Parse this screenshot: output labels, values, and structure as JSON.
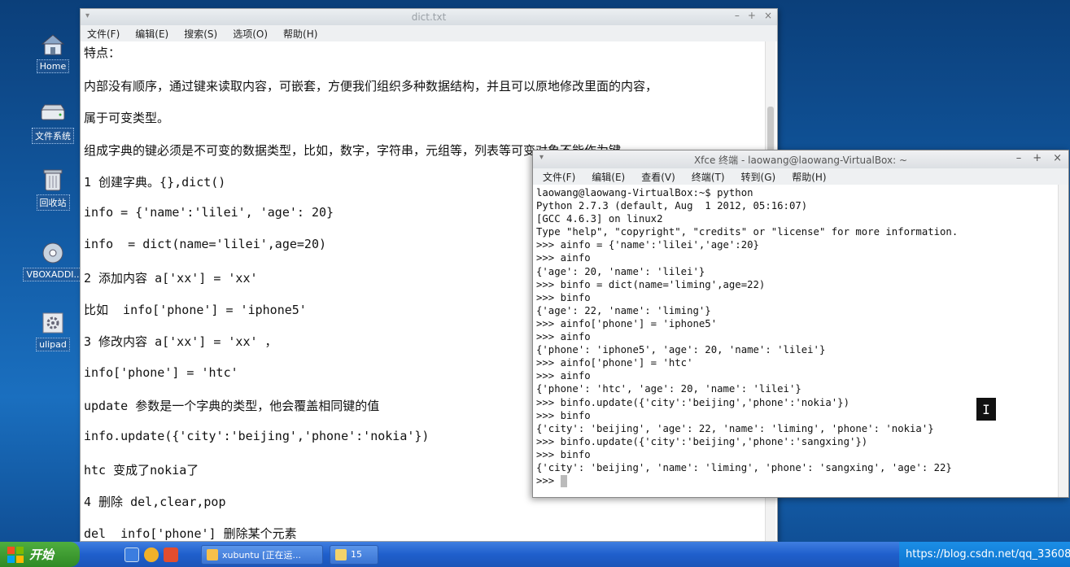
{
  "desktop": {
    "icons": [
      {
        "label": "Home",
        "icon": "home-icon"
      },
      {
        "label": "文件系统",
        "icon": "drive-icon"
      },
      {
        "label": "回收站",
        "icon": "trash-icon"
      },
      {
        "label": "VBOXADDI..",
        "icon": "disc-icon"
      },
      {
        "label": "ulipad",
        "icon": "gear-icon"
      }
    ]
  },
  "editor": {
    "title": "dict.txt",
    "menu": [
      "文件(F)",
      "编辑(E)",
      "搜索(S)",
      "选项(O)",
      "帮助(H)"
    ],
    "lines": [
      "特点：",
      "内部没有顺序，通过键来读取内容，可嵌套，方便我们组织多种数据结构，并且可以原地修改里面的内容，",
      "属于可变类型。",
      "组成字典的键必须是不可变的数据类型，比如，数字，字符串，元组等，列表等可变对象不能作为键。",
      "1 创建字典。{},dict()",
      "info = {'name':'lilei', 'age': 20}",
      "info  = dict(name='lilei',age=20)",
      "2 添加内容 a['xx'] = 'xx'",
      "比如  info['phone'] = 'iphone5'",
      "3 修改内容 a['xx'] = 'xx' ，",
      "info['phone'] = 'htc'",
      "update 参数是一个字典的类型，他会覆盖相同键的值",
      "info.update({'city':'beijing','phone':'nokia'})",
      "htc 变成了nokia了",
      "4 删除 del,clear,pop",
      "del  info['phone'] 删除某个元素"
    ]
  },
  "terminal": {
    "title": "Xfce 终端 - laowang@laowang-VirtualBox: ~",
    "menu": [
      "文件(F)",
      "编辑(E)",
      "查看(V)",
      "终端(T)",
      "转到(G)",
      "帮助(H)"
    ],
    "lines": [
      "laowang@laowang-VirtualBox:~$ python",
      "Python 2.7.3 (default, Aug  1 2012, 05:16:07)",
      "[GCC 4.6.3] on linux2",
      "Type \"help\", \"copyright\", \"credits\" or \"license\" for more information.",
      ">>> ainfo = {'name':'lilei','age':20}",
      ">>> ainfo",
      "{'age': 20, 'name': 'lilei'}",
      ">>> binfo = dict(name='liming',age=22)",
      ">>> binfo",
      "{'age': 22, 'name': 'liming'}",
      ">>> ainfo['phone'] = 'iphone5'",
      ">>> ainfo",
      "{'phone': 'iphone5', 'age': 20, 'name': 'lilei'}",
      ">>> ainfo['phone'] = 'htc'",
      ">>> ainfo",
      "{'phone': 'htc', 'age': 20, 'name': 'lilei'}",
      ">>> binfo.update({'city':'beijing','phone':'nokia'})",
      ">>> binfo",
      "{'city': 'beijing', 'age': 22, 'name': 'liming', 'phone': 'nokia'}",
      ">>> binfo.update({'city':'beijing','phone':'sangxing'})",
      ">>> binfo",
      "{'city': 'beijing', 'name': 'liming', 'phone': 'sangxing', 'age': 22}"
    ],
    "prompt": ">>> "
  },
  "taskbar": {
    "start_label": "开始",
    "tasks": [
      "xubuntu [正在运...",
      "15"
    ],
    "watermark": "https://blog.csdn.net/qq_33608000"
  },
  "colors": {
    "desktop_bg": "#125aa3",
    "taskbar": "#1f5fcc",
    "start": "#2f8a25"
  }
}
